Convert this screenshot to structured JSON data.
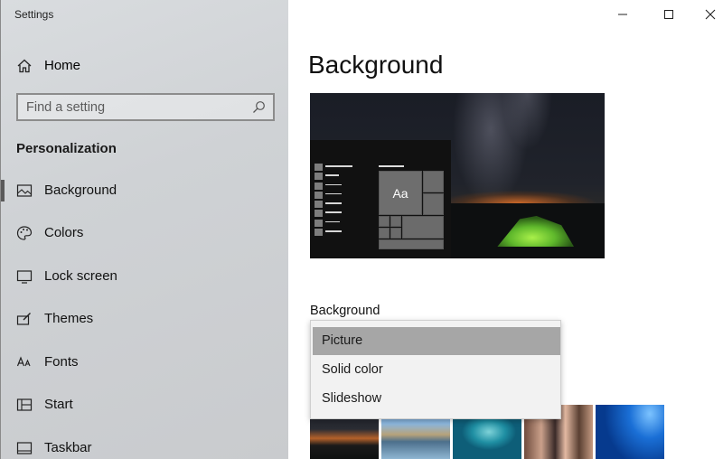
{
  "window": {
    "app_title": "Settings"
  },
  "sidebar": {
    "home_label": "Home",
    "search_placeholder": "Find a setting",
    "section_title": "Personalization",
    "items": [
      {
        "label": "Background",
        "icon": "picture-icon",
        "active": true
      },
      {
        "label": "Colors",
        "icon": "palette-icon",
        "active": false
      },
      {
        "label": "Lock screen",
        "icon": "lock-screen-icon",
        "active": false
      },
      {
        "label": "Themes",
        "icon": "themes-icon",
        "active": false
      },
      {
        "label": "Fonts",
        "icon": "fonts-icon",
        "active": false
      },
      {
        "label": "Start",
        "icon": "start-icon",
        "active": false
      },
      {
        "label": "Taskbar",
        "icon": "taskbar-icon",
        "active": false
      }
    ]
  },
  "main": {
    "page_title": "Background",
    "preview_tile_label": "Aa",
    "background_label": "Background",
    "background_options": [
      "Picture",
      "Solid color",
      "Slideshow"
    ],
    "background_selected": "Picture"
  },
  "colors": {
    "sidebar_bg": "#d3d6d9",
    "selected_option_bg": "#a6a6a6",
    "tent_green": "#7ed13a"
  }
}
